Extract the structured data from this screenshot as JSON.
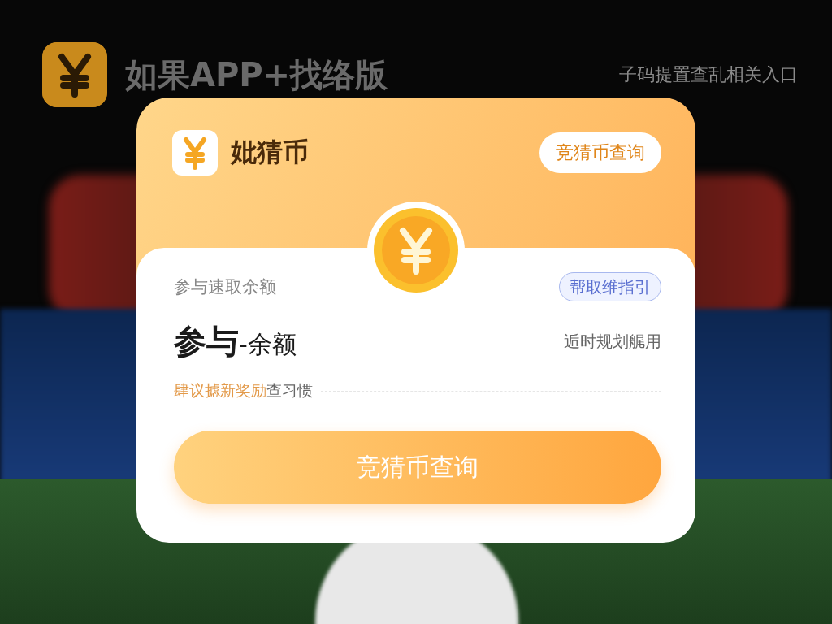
{
  "background_header": {
    "title": "如果APP+找络版",
    "link": "子码提置查乱相关入口"
  },
  "card": {
    "title": "妣猜币",
    "header_button": "竞猜币查询",
    "balance_label": "参与速取余额",
    "guide_tag": "帮取维指引",
    "amount_main": "参与",
    "amount_suffix": "-余额",
    "amount_note": "逅时规划艉用",
    "hint_highlight": "肆议摅新奖励",
    "hint_rest": "查习惯",
    "main_button": "竞猜币查询"
  }
}
